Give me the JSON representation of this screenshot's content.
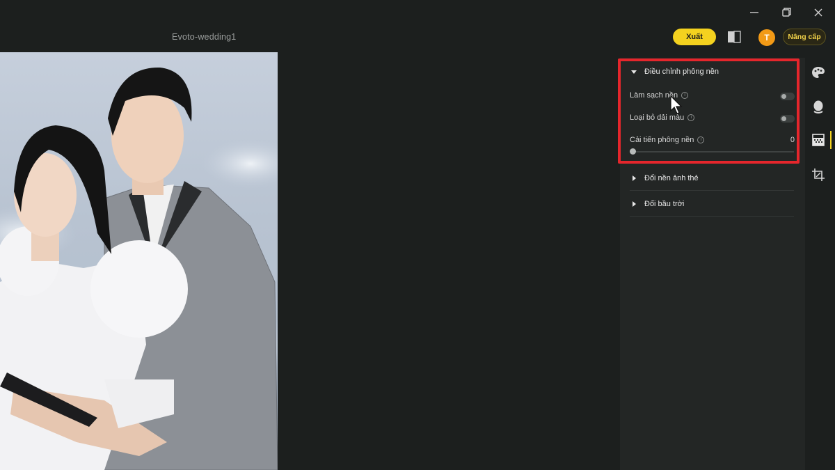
{
  "window": {
    "title": "Evoto-wedding1"
  },
  "header": {
    "export_label": "Xuất",
    "avatar_letter": "T",
    "upgrade_label": "Nâng cấp",
    "accent_color": "#f4d21f"
  },
  "panel": {
    "background_section": {
      "title": "Điều chỉnh phông nền",
      "expanded": true,
      "clean_background": {
        "label": "Làm sạch nền",
        "enabled": false
      },
      "remove_color_band": {
        "label": "Loại bỏ dải màu",
        "enabled": false
      },
      "improve_background": {
        "label": "Cải tiến phông nền",
        "value": "0"
      }
    },
    "id_photo_section": {
      "title": "Đổi nền ảnh thẻ",
      "expanded": false
    },
    "sky_section": {
      "title": "Đổi bầu trời",
      "expanded": false
    }
  },
  "tools": [
    "palette-icon",
    "face-icon",
    "background-icon",
    "crop-icon"
  ],
  "highlight_color": "#e5262c"
}
